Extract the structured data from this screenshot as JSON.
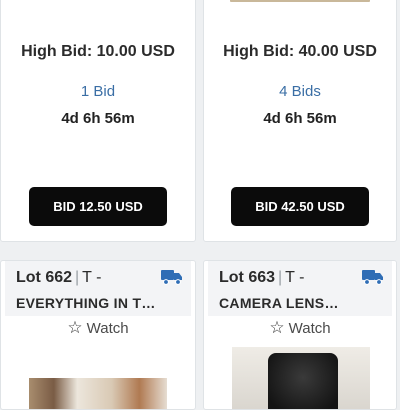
{
  "cards_top": [
    {
      "high_bid": "High Bid: 10.00 USD",
      "bids": "1 Bid",
      "time_left": "4d 6h 56m",
      "bid_button": "BID 12.50 USD"
    },
    {
      "high_bid": "High Bid: 40.00 USD",
      "bids": "4 Bids",
      "time_left": "4d 6h 56m",
      "bid_button": "BID 42.50 USD"
    }
  ],
  "cards_bottom": [
    {
      "lot": "Lot 662",
      "separator": "|",
      "category": "T -",
      "title": "EVERYTHING IN T…",
      "watch": "Watch",
      "shipping_icon": "truck-icon"
    },
    {
      "lot": "Lot 663",
      "separator": "|",
      "category": "T -",
      "title": "CAMERA LENS…",
      "watch": "Watch",
      "shipping_icon": "truck-icon"
    }
  ],
  "colors": {
    "bid_button_bg": "#0b0b0b",
    "link_blue": "#3a6ea5",
    "truck_blue": "#2f6db5"
  }
}
